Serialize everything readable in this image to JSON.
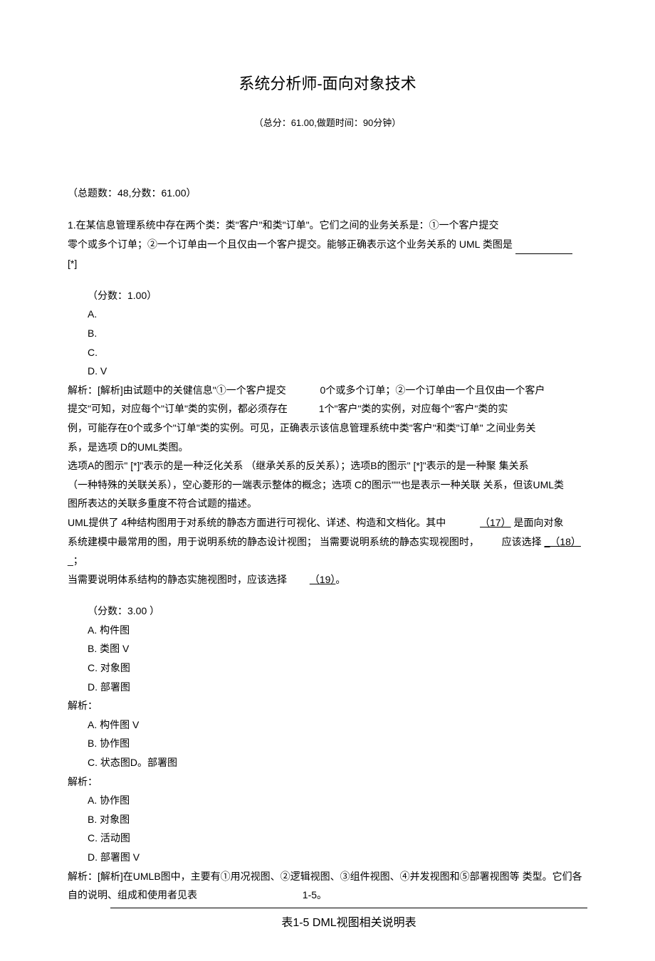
{
  "title": "系统分析师-面向对象技术",
  "subtitle": "（总分：61.00,做题时间：90分钟）",
  "summary": "（总题数：48,分数：61.00）",
  "q1": {
    "intro1": "1.在某信息管理系统中存在两个类：类\"客户\"和类\"订单\"。它们之间的业务关系是：①一个客户提交",
    "intro2a": "零个或多个订单；②一个订单由一个且仅由一个客户提交。能够正确表示这个业务关系的 UML 类图是  ",
    "intro3": "[*]",
    "score": "（分数：1.00）",
    "optA": "A.",
    "optB": "B.",
    "optC": "C.",
    "optD_prefix": "D.    ",
    "optD_mark": "V",
    "analysis1a": "解析：[解析]由试题中的关健信息\"①一个客户提交",
    "analysis1b": "0个或多个订单；②一个订单由一个且仅由一个客户",
    "analysis2a": "提交\"可知，对应每个\"订单\"类的实例，都必须存在",
    "analysis2b": "1个\"客户\"类的实例，对应每个\"客户\"类的实",
    "analysis3": "例，可能存在0个或多个\"订单\"类的实例。可见，正确表示该信息管理系统中类\"客户\"和类\"订单\"  之间业务关",
    "analysis4": "系，是选项 D的UML类图。",
    "analysis5": "选项A的图示\"  [*]\"表示的是一种泛化关系  （继承关系的反关系）；选项B的图示\"  [*]\"表示的是一种聚 集关系",
    "analysis6": "（一种特殊的关联关系），空心菱形的一端表示整体的概念；选项 C的图示\"\"'也是表示一种关联 关系，但该UML类",
    "analysis7": "图所表达的关联多重度不符合试题的描述。"
  },
  "q17": {
    "intro1a": "UML提供了 4种结构图用于对系统的静态方面进行可视化、详述、构造和文档化。其中",
    "link1": "  （17）",
    "intro1b": "是面向对象",
    "intro2a": "系统建模中最常用的图，用于说明系统的静态设计视图；  当需要说明系统的静态实现视图时，",
    "intro2b": "应该选择",
    "link2": "_（18）",
    "intro3a": "_；",
    "intro4": "当需要说明体系结构的静态实施视图时，应该选择",
    "link3": "  （19）",
    "intro4b": "。",
    "score": "（分数：3.00 ）",
    "g1": {
      "A": "A.  构件图",
      "B_prefix": "B.  类图  ",
      "B_mark": "V",
      "C": "C.  对象图",
      "D": "D.  部署图"
    },
    "g1_an": "解析：",
    "g2": {
      "A_prefix": "A.  构件图  ",
      "A_mark": "V",
      "B": "B.  协作图",
      "CD": "C.  状态图D。部署图"
    },
    "g2_an": "解析：",
    "g3": {
      "A": "A.  协作图",
      "B": "B.  对象图",
      "C": "C.  活动图",
      "D_prefix": "D.  部署图  ",
      "D_mark": "V"
    },
    "final1": "解析：[解析]在UMLB图中，主要有①用况视图、②逻辑视图、③组件视图、④并发视图和⑤部署视图等 类型。它们各",
    "final2a": "自的说明、组成和使用者见表",
    "final2b": "1-5。"
  },
  "table_caption": "表1-5 DML视图相关说明表"
}
